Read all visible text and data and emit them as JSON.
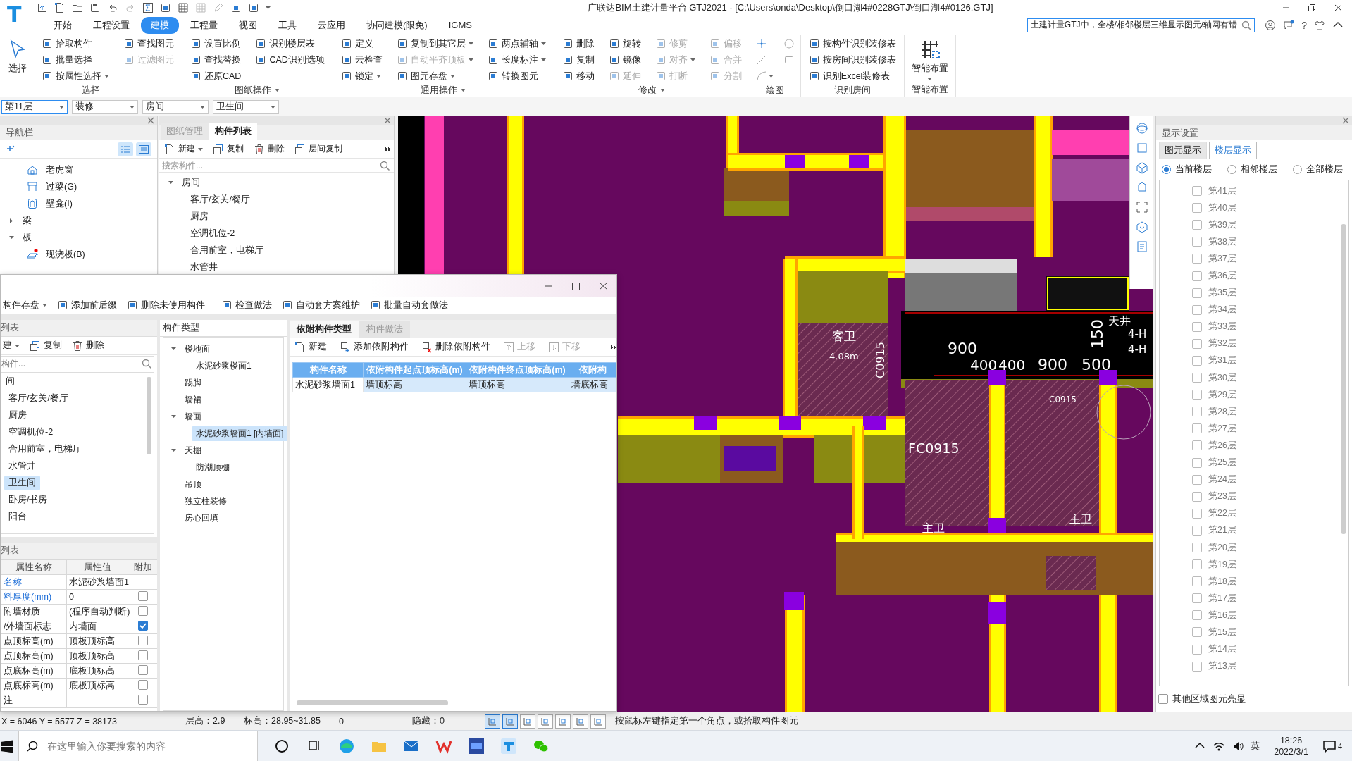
{
  "title_bar": {
    "logo": "T",
    "title": "广联达BIM土建计量平台 GTJ2021 - [C:\\Users\\onda\\Desktop\\倒口湖4#0228GTJ\\倒口湖4#0126.GTJ]",
    "search": {
      "value": "土建计量GTJ中，全楼/相邻楼层三维显示图元/轴网有错"
    },
    "help": "?"
  },
  "menu_tabs": [
    {
      "label": "开始",
      "selected": false
    },
    {
      "label": "工程设置",
      "selected": false
    },
    {
      "label": "建模",
      "selected": true
    },
    {
      "label": "工程量",
      "selected": false
    },
    {
      "label": "视图",
      "selected": false
    },
    {
      "label": "工具",
      "selected": false
    },
    {
      "label": "云应用",
      "selected": false
    },
    {
      "label": "协同建模(限免)",
      "selected": false
    },
    {
      "label": "IGMS",
      "selected": false
    }
  ],
  "ribbon": [
    {
      "label": "选择",
      "label_dropdown": false,
      "columns": [
        [
          {
            "label": "选择",
            "kind": "large",
            "disabled": false,
            "dropdown": false
          }
        ],
        [
          {
            "label": "拾取构件",
            "kind": "small",
            "disabled": false,
            "dropdown": false
          },
          {
            "label": "批量选择",
            "kind": "small",
            "disabled": false,
            "dropdown": false
          },
          {
            "label": "按属性选择",
            "kind": "small",
            "disabled": false,
            "dropdown": true
          }
        ],
        [
          {
            "label": "查找图元",
            "kind": "small",
            "disabled": false,
            "dropdown": false
          },
          {
            "label": "过滤图元",
            "kind": "small",
            "disabled": true,
            "dropdown": false
          }
        ]
      ]
    },
    {
      "label": "图纸操作",
      "label_dropdown": true,
      "columns": [
        [
          {
            "label": "设置比例",
            "kind": "small",
            "disabled": false,
            "dropdown": false
          },
          {
            "label": "查找替换",
            "kind": "small",
            "disabled": false,
            "dropdown": false
          },
          {
            "label": "还原CAD",
            "kind": "small",
            "disabled": false,
            "dropdown": false
          }
        ],
        [
          {
            "label": "识别楼层表",
            "kind": "small",
            "disabled": false,
            "dropdown": false
          },
          {
            "label": "CAD识别选项",
            "kind": "small",
            "disabled": false,
            "dropdown": false
          }
        ]
      ]
    },
    {
      "label": "通用操作",
      "label_dropdown": true,
      "columns": [
        [
          {
            "label": "定义",
            "kind": "small",
            "disabled": false,
            "dropdown": false
          },
          {
            "label": "云检查",
            "kind": "small",
            "disabled": false,
            "dropdown": false
          },
          {
            "label": "锁定",
            "kind": "small",
            "disabled": false,
            "dropdown": true
          }
        ],
        [
          {
            "label": "复制到其它层",
            "kind": "small",
            "disabled": false,
            "dropdown": true
          },
          {
            "label": "自动平齐顶板",
            "kind": "small",
            "disabled": true,
            "dropdown": true
          },
          {
            "label": "图元存盘",
            "kind": "small",
            "disabled": false,
            "dropdown": true
          }
        ],
        [
          {
            "label": "两点辅轴",
            "kind": "small",
            "disabled": false,
            "dropdown": true
          },
          {
            "label": "长度标注",
            "kind": "small",
            "disabled": false,
            "dropdown": true
          },
          {
            "label": "转换图元",
            "kind": "small",
            "disabled": false,
            "dropdown": false
          }
        ]
      ]
    },
    {
      "label": "修改",
      "label_dropdown": true,
      "columns": [
        [
          {
            "label": "删除",
            "kind": "small",
            "disabled": false,
            "dropdown": false
          },
          {
            "label": "复制",
            "kind": "small",
            "disabled": false,
            "dropdown": false
          },
          {
            "label": "移动",
            "kind": "small",
            "disabled": false,
            "dropdown": false
          }
        ],
        [
          {
            "label": "旋转",
            "kind": "small",
            "disabled": false,
            "dropdown": false
          },
          {
            "label": "镜像",
            "kind": "small",
            "disabled": false,
            "dropdown": false
          },
          {
            "label": "延伸",
            "kind": "small",
            "disabled": true,
            "dropdown": false
          }
        ],
        [
          {
            "label": "修剪",
            "kind": "small",
            "disabled": true,
            "dropdown": false
          },
          {
            "label": "对齐",
            "kind": "small",
            "disabled": true,
            "dropdown": true
          },
          {
            "label": "打断",
            "kind": "small",
            "disabled": true,
            "dropdown": false
          }
        ],
        [
          {
            "label": "偏移",
            "kind": "small",
            "disabled": true,
            "dropdown": false
          },
          {
            "label": "合并",
            "kind": "small",
            "disabled": true,
            "dropdown": false
          },
          {
            "label": "分割",
            "kind": "small",
            "disabled": true,
            "dropdown": false
          }
        ]
      ]
    },
    {
      "label": "绘图",
      "label_dropdown": false,
      "columns": [
        [
          {
            "kind": "icon",
            "disabled": false,
            "dropdown": false
          },
          {
            "kind": "icon",
            "disabled": true,
            "dropdown": false
          },
          {
            "kind": "icon",
            "disabled": true,
            "dropdown": true
          }
        ],
        [
          {
            "kind": "icon",
            "disabled": true,
            "dropdown": false
          },
          {
            "kind": "icon",
            "disabled": true,
            "dropdown": false
          }
        ]
      ]
    },
    {
      "label": "识别房间",
      "label_dropdown": false,
      "columns": [
        [
          {
            "label": "按构件识别装修表",
            "kind": "small",
            "disabled": false,
            "dropdown": false
          },
          {
            "label": "按房间识别装修表",
            "kind": "small",
            "disabled": false,
            "dropdown": false
          },
          {
            "label": "识别Excel装修表",
            "kind": "small",
            "disabled": false,
            "dropdown": false
          }
        ]
      ]
    },
    {
      "label": "智能布置",
      "label_dropdown": false,
      "columns": [
        [
          {
            "label": "智能布置",
            "kind": "large",
            "disabled": false,
            "dropdown": true
          }
        ]
      ]
    }
  ],
  "selectors": [
    "第11层",
    "装修",
    "房间",
    "卫生间"
  ],
  "navigation": {
    "title": "导航栏",
    "items": [
      {
        "label": "老虎窗",
        "kind": "dormer"
      },
      {
        "label": "过梁(G)",
        "kind": "lintel"
      },
      {
        "label": "壁龛(I)",
        "kind": "niche"
      },
      {
        "label": "梁",
        "kind": "group",
        "expanded": false
      },
      {
        "label": "板",
        "kind": "group",
        "expanded": true,
        "children": [
          {
            "label": "现浇板(B)",
            "kind": "slab",
            "marked": true
          }
        ]
      }
    ]
  },
  "component_panel": {
    "tabs": [
      {
        "label": "图纸管理",
        "selected": false
      },
      {
        "label": "构件列表",
        "selected": true
      }
    ],
    "toolbar": [
      {
        "label": "新建",
        "dropdown": true
      },
      {
        "label": "复制",
        "dropdown": false
      },
      {
        "label": "删除",
        "dropdown": false
      },
      {
        "label": "层间复制",
        "dropdown": false
      }
    ],
    "search": {
      "placeholder": "搜索构件..."
    },
    "tree": [
      {
        "label": "房间",
        "expanded": true,
        "children": [
          {
            "label": "客厅/玄关/餐厅"
          },
          {
            "label": "厨房"
          },
          {
            "label": "空调机位-2"
          },
          {
            "label": "合用前室，电梯厅"
          },
          {
            "label": "水管井"
          }
        ]
      }
    ]
  },
  "canvas": {
    "labels": [
      "客卫",
      "4.08m",
      "C0915",
      "900",
      "400",
      "400",
      "900",
      "500",
      "150",
      "天井",
      "4-H",
      "4-H",
      "FC0915",
      "C0915",
      "主卫",
      "主卫"
    ]
  },
  "display_settings": {
    "title": "显示设置",
    "tabs": [
      {
        "label": "图元显示",
        "selected": false
      },
      {
        "label": "楼层显示",
        "selected": true
      }
    ],
    "scope": [
      {
        "label": "当前楼层",
        "selected": true
      },
      {
        "label": "相邻楼层",
        "selected": false
      },
      {
        "label": "全部楼层",
        "selected": false
      }
    ],
    "floors": [
      {
        "label": "第41层",
        "checked": false
      },
      {
        "label": "第40层",
        "checked": false
      },
      {
        "label": "第39层",
        "checked": false
      },
      {
        "label": "第38层",
        "checked": false
      },
      {
        "label": "第37层",
        "checked": false
      },
      {
        "label": "第36层",
        "checked": false
      },
      {
        "label": "第35层",
        "checked": false
      },
      {
        "label": "第34层",
        "checked": false
      },
      {
        "label": "第33层",
        "checked": false
      },
      {
        "label": "第32层",
        "checked": false
      },
      {
        "label": "第31层",
        "checked": false
      },
      {
        "label": "第30层",
        "checked": false
      },
      {
        "label": "第29层",
        "checked": false
      },
      {
        "label": "第28层",
        "checked": false
      },
      {
        "label": "第27层",
        "checked": false
      },
      {
        "label": "第26层",
        "checked": false
      },
      {
        "label": "第25层",
        "checked": false
      },
      {
        "label": "第24层",
        "checked": false
      },
      {
        "label": "第23层",
        "checked": false
      },
      {
        "label": "第22层",
        "checked": false
      },
      {
        "label": "第21层",
        "checked": false
      },
      {
        "label": "第20层",
        "checked": false
      },
      {
        "label": "第19层",
        "checked": false
      },
      {
        "label": "第18层",
        "checked": false
      },
      {
        "label": "第17层",
        "checked": false
      },
      {
        "label": "第16层",
        "checked": false
      },
      {
        "label": "第15层",
        "checked": false
      },
      {
        "label": "第14层",
        "checked": false
      },
      {
        "label": "第13层",
        "checked": false
      }
    ],
    "highlight_other": {
      "label": "其他区域图元亮显",
      "checked": false
    }
  },
  "dialog": {
    "toolbar": [
      {
        "label": "构件存盘",
        "dropdown": true
      },
      {
        "label": "添加前后缀",
        "dropdown": false
      },
      {
        "label": "删除未使用构件",
        "dropdown": false
      },
      {
        "label": "检查做法",
        "dropdown": false
      },
      {
        "label": "自动套方案维护",
        "dropdown": false
      },
      {
        "label": "批量自动套做法",
        "dropdown": false
      }
    ],
    "list_panel": {
      "title": "列表",
      "toolbar": [
        {
          "label": "建",
          "dropdown": true
        },
        {
          "label": "复制",
          "dropdown": false
        },
        {
          "label": "删除",
          "dropdown": false
        }
      ],
      "search": {
        "placeholder": "构件..."
      },
      "tree": [
        {
          "label": "间",
          "selected": false,
          "children": [
            {
              "label": "客厅/玄关/餐厅",
              "selected": false
            },
            {
              "label": "厨房",
              "selected": false
            },
            {
              "label": "空调机位-2",
              "selected": false
            },
            {
              "label": "合用前室，电梯厅",
              "selected": false
            },
            {
              "label": "水管井",
              "selected": false
            },
            {
              "label": "卫生间",
              "selected": true
            },
            {
              "label": "卧房/书房",
              "selected": false
            },
            {
              "label": "阳台",
              "selected": false
            }
          ]
        }
      ]
    },
    "properties": {
      "title": "列表",
      "columns": [
        "属性名称",
        "属性值",
        "附加"
      ],
      "rows": [
        {
          "name": "名称",
          "value": "水泥砂浆墙面1",
          "public": true
        },
        {
          "name": "料厚度(mm)",
          "value": "0",
          "public": true,
          "attached": false
        },
        {
          "name": "附墙材质",
          "value": "(程序自动判断)",
          "public": false,
          "attached": false
        },
        {
          "name": "/外墙面标志",
          "value": "内墙面",
          "public": false,
          "attached": true
        },
        {
          "name": "点顶标高(m)",
          "value": "顶板顶标高",
          "public": false,
          "attached": false
        },
        {
          "name": "点顶标高(m)",
          "value": "顶板顶标高",
          "public": false,
          "attached": false
        },
        {
          "name": "点底标高(m)",
          "value": "底板顶标高",
          "public": false,
          "attached": false
        },
        {
          "name": "点底标高(m)",
          "value": "底板顶标高",
          "public": false,
          "attached": false
        },
        {
          "name": "注",
          "value": "",
          "public": false,
          "attached": false
        }
      ]
    },
    "types_panel": {
      "title": "构件类型",
      "tree": [
        {
          "label": "楼地面",
          "selected": false,
          "expanded": true,
          "children": [
            {
              "label": "水泥砂浆楼面1",
              "selected": false
            }
          ]
        },
        {
          "label": "踢脚",
          "selected": false
        },
        {
          "label": "墙裙",
          "selected": false
        },
        {
          "label": "墙面",
          "selected": false,
          "expanded": true,
          "children": [
            {
              "label": "水泥砂浆墙面1 [内墙面]",
              "selected": true
            }
          ]
        },
        {
          "label": "天棚",
          "selected": false,
          "expanded": true,
          "children": [
            {
              "label": "防潮顶棚",
              "selected": false
            }
          ]
        },
        {
          "label": "吊顶",
          "selected": false
        },
        {
          "label": "独立柱装修",
          "selected": false
        },
        {
          "label": "房心回填",
          "selected": false
        }
      ]
    },
    "attachments": {
      "tabs": [
        {
          "label": "依附构件类型",
          "selected": true
        },
        {
          "label": "构件做法",
          "selected": false
        }
      ],
      "toolbar": [
        {
          "label": "新建",
          "disabled": false
        },
        {
          "label": "添加依附构件",
          "disabled": false
        },
        {
          "label": "删除依附构件",
          "disabled": false
        },
        {
          "label": "上移",
          "disabled": true
        },
        {
          "label": "下移",
          "disabled": true
        }
      ],
      "columns": [
        "构件名称",
        "依附构件起点顶标高(m)",
        "依附构件终点顶标高(m)",
        "依附构"
      ],
      "rows": [
        {
          "cells": [
            "水泥砂浆墙面1",
            "墙顶标高",
            "墙顶标高",
            "墙底标高"
          ],
          "selected": true
        }
      ]
    }
  },
  "status_bar": {
    "coordinates": "X = 6046 Y = 5577 Z = 38173",
    "floor_height": "层高：2.9",
    "elevation": "标高：28.95~31.85",
    "count": "0",
    "hidden": "隐藏：0",
    "toggles": [
      {
        "selected": true
      },
      {
        "selected": true
      },
      {
        "selected": false
      },
      {
        "selected": false
      },
      {
        "selected": false
      },
      {
        "selected": false
      },
      {
        "selected": false
      }
    ],
    "prompt": "按鼠标左键指定第一个角点，或拾取构件图元"
  },
  "taskbar": {
    "search": {
      "placeholder": "在这里输入你要搜索的内容"
    },
    "ime": "英",
    "time": "18:26",
    "date": "2022/3/1",
    "notifications": "4"
  }
}
